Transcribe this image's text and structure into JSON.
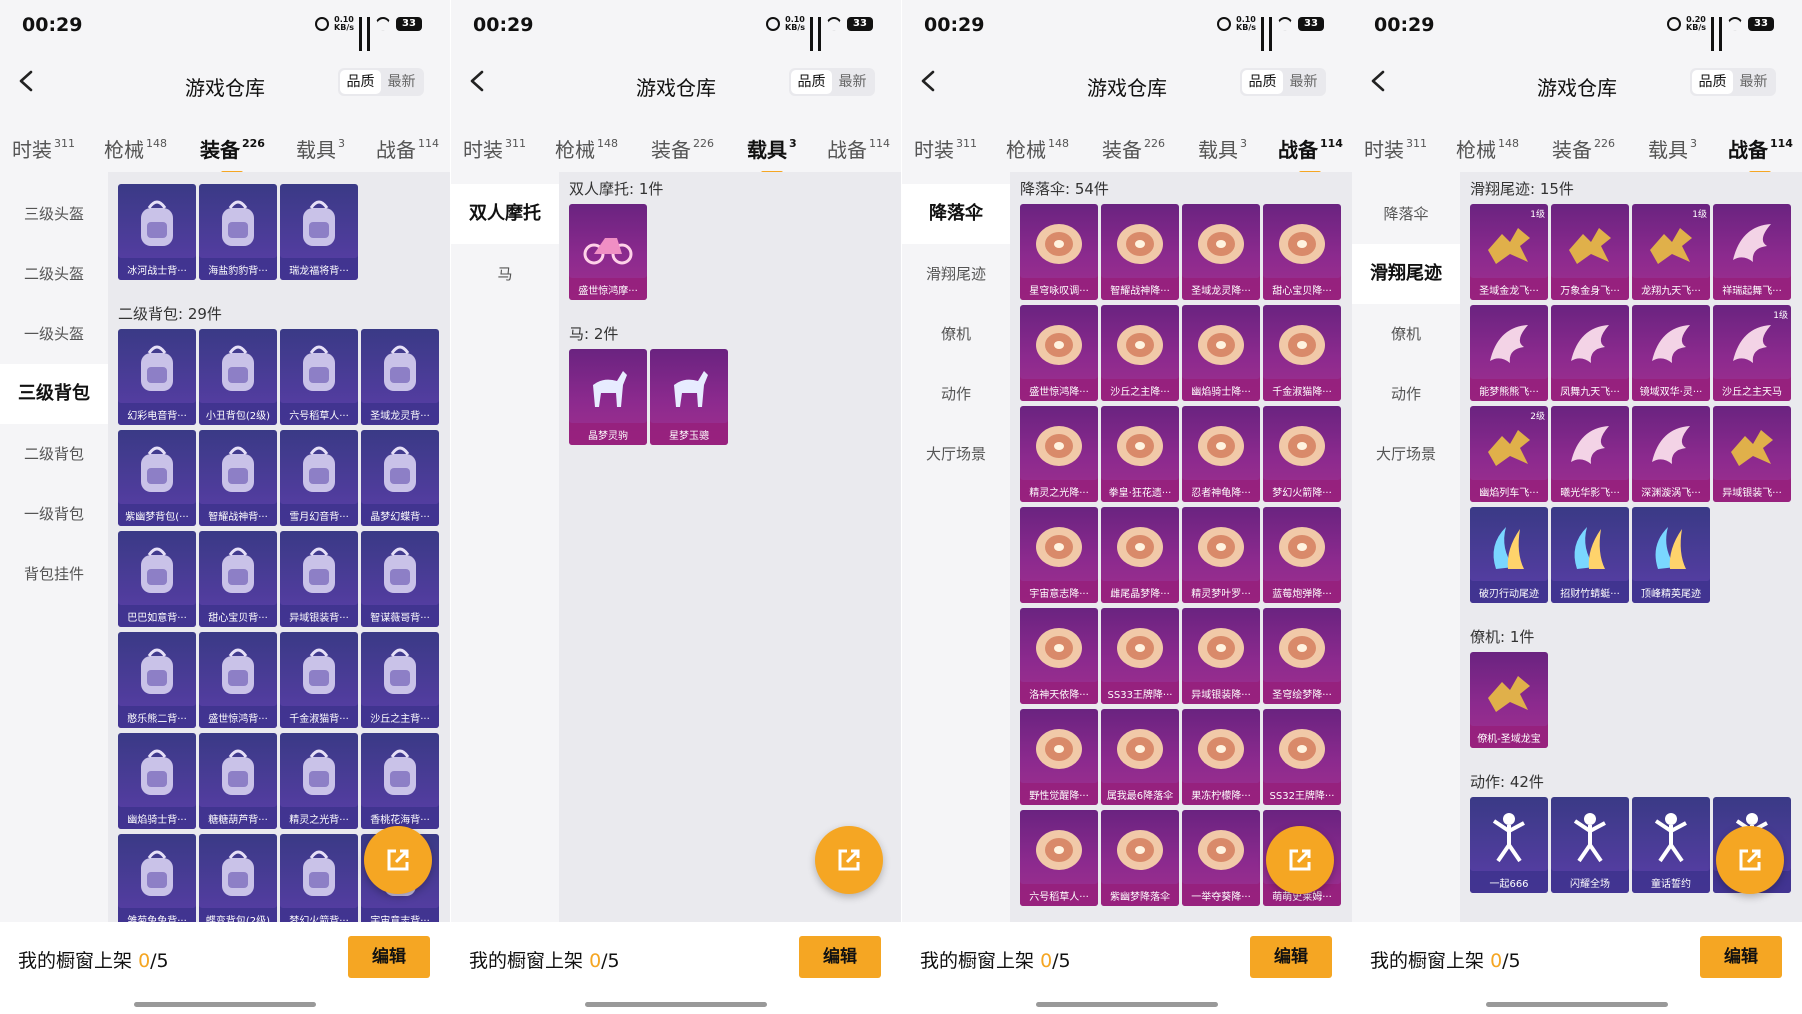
{
  "colors": {
    "accent": "#f5a623",
    "rarity_purple": "#4d3c9a",
    "rarity_pink": "#8c2a8e"
  },
  "panels": [
    {
      "status": {
        "time": "00:29",
        "net": "0.10\nKB/s",
        "battery": "33"
      },
      "header": {
        "title": "游戏仓库",
        "sort_quality": "品质",
        "sort_latest": "最新"
      },
      "tabs": [
        {
          "label": "时装",
          "count": "311"
        },
        {
          "label": "枪械",
          "count": "148"
        },
        {
          "label": "装备",
          "count": "226"
        },
        {
          "label": "载具",
          "count": "3"
        },
        {
          "label": "战备",
          "count": "114"
        }
      ],
      "active_tab": 2,
      "side": [
        "三级头盔",
        "二级头盔",
        "一级头盔",
        "三级背包",
        "二级背包",
        "一级背包",
        "背包挂件"
      ],
      "active_side": 3,
      "sections": [
        {
          "title": "",
          "items": [
            {
              "name": "冰河战士背···",
              "icon": "backpack-icon",
              "rarity": "purple"
            },
            {
              "name": "海盐豹豹背···",
              "icon": "backpack-icon",
              "rarity": "purple"
            },
            {
              "name": "瑞龙福将背···",
              "icon": "backpack-icon",
              "rarity": "purple"
            }
          ]
        },
        {
          "title": "二级背包: 29件",
          "items": [
            {
              "name": "幻彩电音背···",
              "icon": "backpack-icon",
              "rarity": "purple"
            },
            {
              "name": "小丑背包(2级)",
              "icon": "backpack-icon",
              "rarity": "purple"
            },
            {
              "name": "六号稻草人···",
              "icon": "backpack-icon",
              "rarity": "purple"
            },
            {
              "name": "圣域龙灵背···",
              "icon": "backpack-icon",
              "rarity": "purple"
            },
            {
              "name": "紫幽梦背包(···",
              "icon": "backpack-icon",
              "rarity": "purple"
            },
            {
              "name": "智耀战神背···",
              "icon": "backpack-icon",
              "rarity": "purple"
            },
            {
              "name": "雪月幻音背···",
              "icon": "backpack-icon",
              "rarity": "purple"
            },
            {
              "name": "晶梦幻蝶背···",
              "icon": "backpack-icon",
              "rarity": "purple"
            },
            {
              "name": "巴巴如意背···",
              "icon": "backpack-icon",
              "rarity": "purple"
            },
            {
              "name": "甜心宝贝背···",
              "icon": "backpack-icon",
              "rarity": "purple"
            },
            {
              "name": "异域银装背···",
              "icon": "backpack-icon",
              "rarity": "purple"
            },
            {
              "name": "智谋薇哥背···",
              "icon": "backpack-icon",
              "rarity": "purple"
            },
            {
              "name": "憨乐熊二背···",
              "icon": "backpack-icon",
              "rarity": "purple"
            },
            {
              "name": "盛世惊鸿背···",
              "icon": "backpack-icon",
              "rarity": "purple"
            },
            {
              "name": "千金淑猫背···",
              "icon": "backpack-icon",
              "rarity": "purple"
            },
            {
              "name": "沙丘之主背···",
              "icon": "backpack-icon",
              "rarity": "purple"
            },
            {
              "name": "幽焰骑士背···",
              "icon": "backpack-icon",
              "rarity": "purple"
            },
            {
              "name": "糖糖葫芦背···",
              "icon": "backpack-icon",
              "rarity": "purple"
            },
            {
              "name": "精灵之光背···",
              "icon": "backpack-icon",
              "rarity": "purple"
            },
            {
              "name": "香桃花海背···",
              "icon": "backpack-icon",
              "rarity": "purple"
            },
            {
              "name": "雏菊兔兔背···",
              "icon": "backpack-icon",
              "rarity": "purple"
            },
            {
              "name": "蝶变背包(2级)",
              "icon": "backpack-icon",
              "rarity": "purple"
            },
            {
              "name": "梦幻火箭背···",
              "icon": "backpack-icon",
              "rarity": "purple"
            },
            {
              "name": "宇宙意志背···",
              "icon": "backpack-icon",
              "rarity": "purple"
            }
          ]
        }
      ],
      "footer": {
        "shelf_label": "我的橱窗上架",
        "shelf_count": "0",
        "shelf_total": "/5",
        "edit": "编辑"
      }
    },
    {
      "status": {
        "time": "00:29",
        "net": "0.10\nKB/s",
        "battery": "33"
      },
      "header": {
        "title": "游戏仓库",
        "sort_quality": "品质",
        "sort_latest": "最新"
      },
      "tabs": [
        {
          "label": "时装",
          "count": "311"
        },
        {
          "label": "枪械",
          "count": "148"
        },
        {
          "label": "装备",
          "count": "226"
        },
        {
          "label": "载具",
          "count": "3"
        },
        {
          "label": "战备",
          "count": "114"
        }
      ],
      "active_tab": 3,
      "side": [
        "双人摩托",
        "马"
      ],
      "active_side": 0,
      "sections": [
        {
          "title": "双人摩托: 1件",
          "items": [
            {
              "name": "盛世惊鸿摩···",
              "icon": "motorcycle-icon",
              "rarity": "pink"
            }
          ]
        },
        {
          "title": "马: 2件",
          "items": [
            {
              "name": "晶梦灵驹",
              "icon": "horse-icon",
              "rarity": "pink"
            },
            {
              "name": "星梦玉骢",
              "icon": "horse-icon",
              "rarity": "pink"
            }
          ]
        }
      ],
      "footer": {
        "shelf_label": "我的橱窗上架",
        "shelf_count": "0",
        "shelf_total": "/5",
        "edit": "编辑"
      }
    },
    {
      "status": {
        "time": "00:29",
        "net": "0.10\nKB/s",
        "battery": "33"
      },
      "header": {
        "title": "游戏仓库",
        "sort_quality": "品质",
        "sort_latest": "最新"
      },
      "tabs": [
        {
          "label": "时装",
          "count": "311"
        },
        {
          "label": "枪械",
          "count": "148"
        },
        {
          "label": "装备",
          "count": "226"
        },
        {
          "label": "载具",
          "count": "3"
        },
        {
          "label": "战备",
          "count": "114"
        }
      ],
      "active_tab": 4,
      "side": [
        "降落伞",
        "滑翔尾迹",
        "僚机",
        "动作",
        "大厅场景"
      ],
      "active_side": 0,
      "sections": [
        {
          "title": "降落伞: 54件",
          "items": [
            {
              "name": "星穹咏叹调···",
              "icon": "parachute-icon",
              "rarity": "pink"
            },
            {
              "name": "智耀战神降···",
              "icon": "parachute-icon",
              "rarity": "pink"
            },
            {
              "name": "圣域龙灵降···",
              "icon": "parachute-icon",
              "rarity": "pink"
            },
            {
              "name": "甜心宝贝降···",
              "icon": "parachute-icon",
              "rarity": "pink"
            },
            {
              "name": "盛世惊鸿降···",
              "icon": "parachute-icon",
              "rarity": "pink"
            },
            {
              "name": "沙丘之主降···",
              "icon": "parachute-icon",
              "rarity": "pink"
            },
            {
              "name": "幽焰骑士降···",
              "icon": "parachute-icon",
              "rarity": "pink"
            },
            {
              "name": "千金淑猫降···",
              "icon": "parachute-icon",
              "rarity": "pink"
            },
            {
              "name": "精灵之光降···",
              "icon": "parachute-icon",
              "rarity": "pink"
            },
            {
              "name": "拳皇·狂花遗···",
              "icon": "parachute-icon",
              "rarity": "pink"
            },
            {
              "name": "忍者神龟降···",
              "icon": "parachute-icon",
              "rarity": "pink"
            },
            {
              "name": "梦幻火箭降···",
              "icon": "parachute-icon",
              "rarity": "pink"
            },
            {
              "name": "宇宙意志降···",
              "icon": "parachute-icon",
              "rarity": "pink"
            },
            {
              "name": "雌尾晶梦降···",
              "icon": "parachute-icon",
              "rarity": "pink"
            },
            {
              "name": "精灵梦叶罗···",
              "icon": "parachute-icon",
              "rarity": "pink"
            },
            {
              "name": "蓝莓炮弹降···",
              "icon": "parachute-icon",
              "rarity": "pink"
            },
            {
              "name": "洛神天依降···",
              "icon": "parachute-icon",
              "rarity": "pink"
            },
            {
              "name": "SS33王牌降···",
              "icon": "parachute-icon",
              "rarity": "pink"
            },
            {
              "name": "异域银装降···",
              "icon": "parachute-icon",
              "rarity": "pink"
            },
            {
              "name": "圣穹绘梦降···",
              "icon": "parachute-icon",
              "rarity": "pink"
            },
            {
              "name": "野性觉醒降···",
              "icon": "parachute-icon",
              "rarity": "pink"
            },
            {
              "name": "属我最6降落伞",
              "icon": "parachute-icon",
              "rarity": "pink"
            },
            {
              "name": "果冻柠檬降···",
              "icon": "parachute-icon",
              "rarity": "pink"
            },
            {
              "name": "SS32王牌降···",
              "icon": "parachute-icon",
              "rarity": "pink"
            },
            {
              "name": "六号稻草人···",
              "icon": "parachute-icon",
              "rarity": "pink"
            },
            {
              "name": "紫幽梦降落伞",
              "icon": "parachute-icon",
              "rarity": "pink"
            },
            {
              "name": "一举夺葵降···",
              "icon": "parachute-icon",
              "rarity": "pink"
            },
            {
              "name": "萌萌史莱姆···",
              "icon": "parachute-icon",
              "rarity": "pink"
            }
          ]
        }
      ],
      "footer": {
        "shelf_label": "我的橱窗上架",
        "shelf_count": "0",
        "shelf_total": "/5",
        "edit": "编辑"
      }
    },
    {
      "status": {
        "time": "00:29",
        "net": "0.20\nKB/s",
        "battery": "33"
      },
      "header": {
        "title": "游戏仓库",
        "sort_quality": "品质",
        "sort_latest": "最新"
      },
      "tabs": [
        {
          "label": "时装",
          "count": "311"
        },
        {
          "label": "枪械",
          "count": "148"
        },
        {
          "label": "装备",
          "count": "226"
        },
        {
          "label": "载具",
          "count": "3"
        },
        {
          "label": "战备",
          "count": "114"
        }
      ],
      "active_tab": 4,
      "side": [
        "降落伞",
        "滑翔尾迹",
        "僚机",
        "动作",
        "大厅场景"
      ],
      "active_side": 1,
      "sections": [
        {
          "title": "滑翔尾迹: 15件",
          "items": [
            {
              "name": "圣域金龙飞···",
              "icon": "dragon-icon",
              "rarity": "pink",
              "badge": "1级"
            },
            {
              "name": "万象金身飞···",
              "icon": "dragon-icon",
              "rarity": "pink"
            },
            {
              "name": "龙翔九天飞···",
              "icon": "dragon-icon",
              "rarity": "pink",
              "badge": "1级"
            },
            {
              "name": "祥瑞起舞飞···",
              "icon": "wing-icon",
              "rarity": "pink"
            },
            {
              "name": "能梦熊熊飞···",
              "icon": "wing-icon",
              "rarity": "pink"
            },
            {
              "name": "凤舞九天飞···",
              "icon": "wing-icon",
              "rarity": "pink"
            },
            {
              "name": "镜域双华·灵···",
              "icon": "wing-icon",
              "rarity": "pink"
            },
            {
              "name": "沙丘之主天马",
              "icon": "wing-icon",
              "rarity": "pink",
              "badge": "1级"
            },
            {
              "name": "幽焰列车飞···",
              "icon": "dragon-icon",
              "rarity": "pink",
              "badge": "2级"
            },
            {
              "name": "曦光华影飞···",
              "icon": "wing-icon",
              "rarity": "pink"
            },
            {
              "name": "深渊漩涡飞···",
              "icon": "wing-icon",
              "rarity": "pink"
            },
            {
              "name": "异域银装飞···",
              "icon": "dragon-icon",
              "rarity": "pink"
            },
            {
              "name": "破刃行动尾迹",
              "icon": "trail-icon",
              "rarity": "purple"
            },
            {
              "name": "招财竹蜻蜓···",
              "icon": "trail-icon",
              "rarity": "purple"
            },
            {
              "name": "顶峰精英尾迹",
              "icon": "trail-icon",
              "rarity": "purple"
            }
          ]
        },
        {
          "title": "僚机: 1件",
          "items": [
            {
              "name": "僚机-圣域龙宝",
              "icon": "dragon-icon",
              "rarity": "pink"
            }
          ]
        },
        {
          "title": "动作: 42件",
          "items": [
            {
              "name": "一起666",
              "icon": "dance-icon",
              "rarity": "purple"
            },
            {
              "name": "闪耀全场",
              "icon": "dance-icon",
              "rarity": "purple"
            },
            {
              "name": "童话誓约",
              "icon": "dance-icon",
              "rarity": "purple"
            },
            {
              "name": "",
              "icon": "dance-icon",
              "rarity": "purple"
            }
          ]
        }
      ],
      "footer": {
        "shelf_label": "我的橱窗上架",
        "shelf_count": "0",
        "shelf_total": "/5",
        "edit": "编辑"
      }
    }
  ]
}
